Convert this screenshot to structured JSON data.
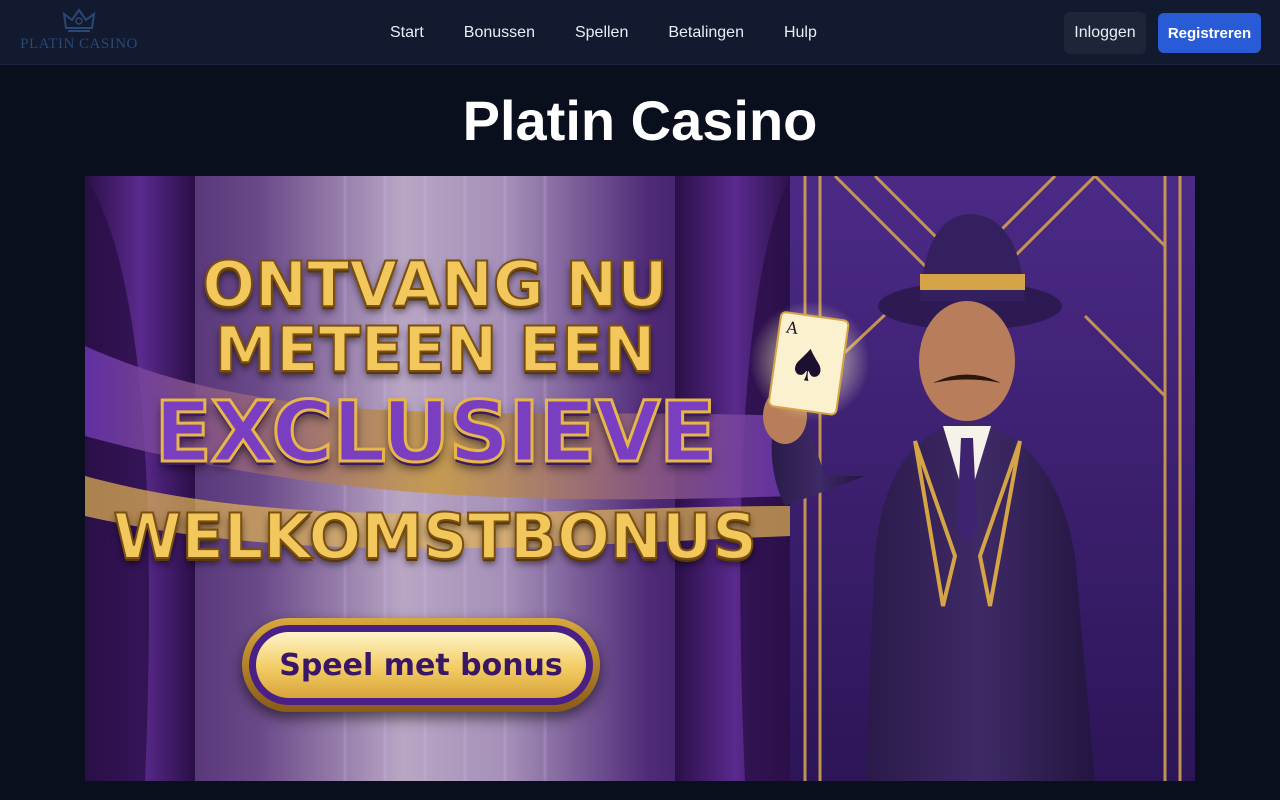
{
  "header": {
    "logo_text": "PLATIN CASINO",
    "logo_icon": "crown-emblem-icon",
    "nav": [
      {
        "label": "Start"
      },
      {
        "label": "Bonussen"
      },
      {
        "label": "Spellen"
      },
      {
        "label": "Betalingen"
      },
      {
        "label": "Hulp"
      }
    ],
    "login_label": "Inloggen",
    "register_label": "Registreren"
  },
  "main": {
    "title": "Platin Casino",
    "banner": {
      "headline_line1": "ONTVANG NU",
      "headline_line2": "METEEN EEN",
      "headline_line3": "EXCLUSIEVE",
      "headline_line4": "WELKOMSTBONUS",
      "cta_label": "Speel met bonus",
      "card_rank": "A",
      "card_suit": "♠"
    }
  },
  "colors": {
    "page_bg": "#0a0f1e",
    "header_bg": "#111a2e",
    "register_button": "#2a5bd7",
    "login_button": "#1d2538",
    "gold": "#f2c75c",
    "purple": "#4a1f86"
  }
}
